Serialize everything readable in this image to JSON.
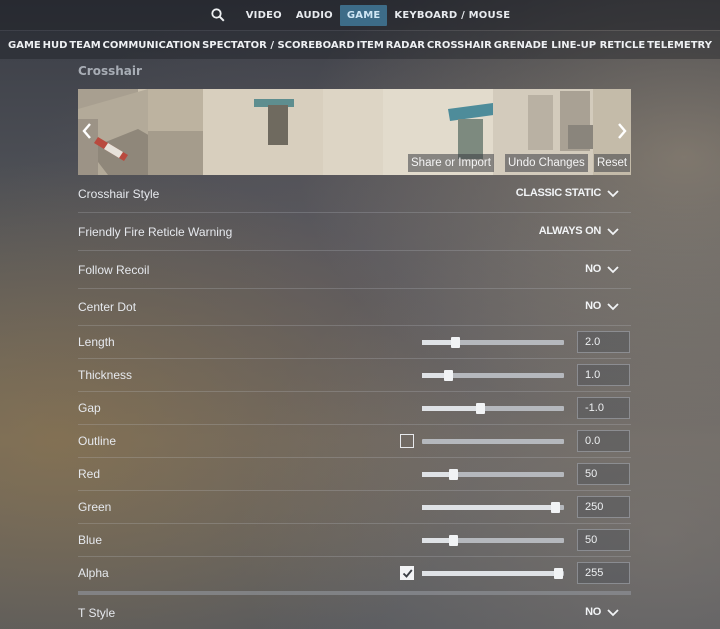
{
  "top_tabs": [
    {
      "label": "VIDEO",
      "active": false
    },
    {
      "label": "AUDIO",
      "active": false
    },
    {
      "label": "GAME",
      "active": true
    },
    {
      "label": "KEYBOARD / MOUSE",
      "active": false
    }
  ],
  "sub_tabs": [
    "GAME",
    "HUD",
    "TEAM",
    "COMMUNICATION",
    "SPECTATOR / SCOREBOARD",
    "ITEM",
    "RADAR",
    "CROSSHAIR",
    "GRENADE LINE-UP RETICLE",
    "TELEMETRY"
  ],
  "section_title": "Crosshair",
  "preview": {
    "share_label": "Share or Import",
    "undo_label": "Undo Changes",
    "reset_label": "Reset"
  },
  "dropdowns": [
    {
      "label": "Crosshair Style",
      "value": "CLASSIC STATIC"
    },
    {
      "label": "Friendly Fire Reticle Warning",
      "value": "ALWAYS ON"
    },
    {
      "label": "Follow Recoil",
      "value": "NO"
    },
    {
      "label": "Center Dot",
      "value": "NO"
    }
  ],
  "sliders": [
    {
      "label": "Length",
      "value": "2.0",
      "level": 0.23,
      "checkbox": null
    },
    {
      "label": "Thickness",
      "value": "1.0",
      "level": 0.18,
      "checkbox": null
    },
    {
      "label": "Gap",
      "value": "-1.0",
      "level": 0.41,
      "checkbox": null
    },
    {
      "label": "Outline",
      "value": "0.0",
      "level": 0.0,
      "checkbox": false
    },
    {
      "label": "Red",
      "value": "50",
      "level": 0.22,
      "checkbox": null
    },
    {
      "label": "Green",
      "value": "250",
      "level": 0.94,
      "checkbox": null
    },
    {
      "label": "Blue",
      "value": "50",
      "level": 0.22,
      "checkbox": null
    },
    {
      "label": "Alpha",
      "value": "255",
      "level": 0.96,
      "checkbox": true
    }
  ],
  "bottom_dropdown": {
    "label": "T Style",
    "value": "NO"
  },
  "colors": {
    "active_tab": "#3d6c88"
  }
}
